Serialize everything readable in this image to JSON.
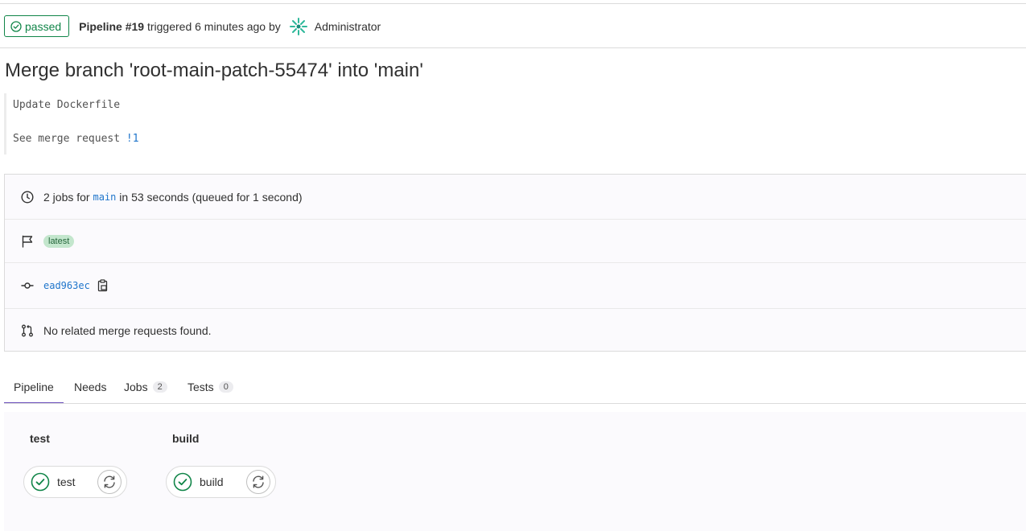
{
  "header": {
    "status_label": "passed",
    "pipeline_label": "Pipeline #19",
    "triggered_text": "triggered 6 minutes ago by",
    "user_name": "Administrator"
  },
  "commit": {
    "title": "Merge branch 'root-main-patch-55474' into 'main'",
    "message_line1": "Update Dockerfile",
    "message_line2_prefix": "See merge request ",
    "merge_request_ref": "!1"
  },
  "info": {
    "jobs_prefix": "2 jobs for ",
    "branch": "main",
    "jobs_suffix": " in 53 seconds (queued for 1 second)",
    "badge": "latest",
    "sha": "ead963ec",
    "merge_requests_text": "No related merge requests found."
  },
  "tabs": [
    {
      "label": "Pipeline",
      "active": true
    },
    {
      "label": "Needs"
    },
    {
      "label": "Jobs",
      "count": "2"
    },
    {
      "label": "Tests",
      "count": "0"
    }
  ],
  "stages": [
    {
      "title": "test",
      "job": "test",
      "status": "success"
    },
    {
      "title": "build",
      "job": "build",
      "status": "success"
    }
  ],
  "colors": {
    "success": "#108548",
    "link": "#1f75cb",
    "active_tab": "#6b4fbb",
    "badge_bg": "#c3e6cd"
  }
}
